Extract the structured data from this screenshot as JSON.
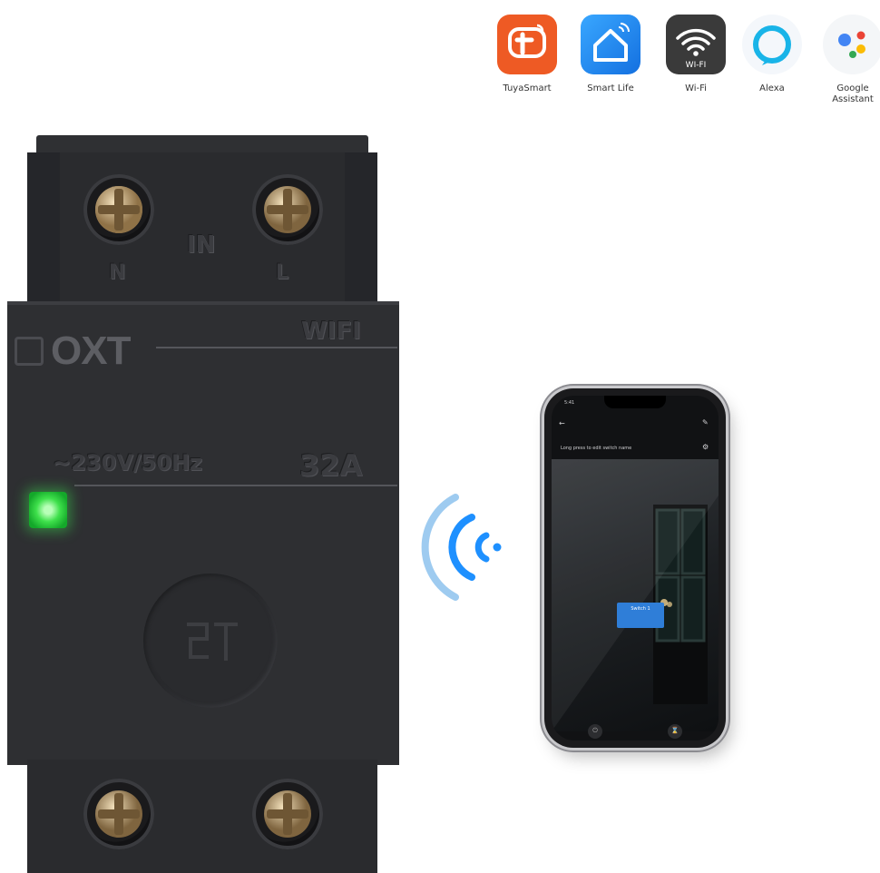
{
  "apps": [
    {
      "label": "TuyaSmart",
      "icon": "tuya-icon",
      "color": "#ee5a24"
    },
    {
      "label": "Smart Life",
      "icon": "smart-life-icon",
      "color": "#1e90ff"
    },
    {
      "label": "Wi-Fi",
      "icon": "wifi-icon",
      "color": "#3a3a3a",
      "badge": "WI-FI"
    },
    {
      "label": "Alexa",
      "icon": "alexa-icon",
      "color": "#19b4e8"
    },
    {
      "label": "Google Assistant",
      "icon": "google-assistant-icon",
      "color": "#4285f4"
    }
  ],
  "device": {
    "terminal_top_left": "N",
    "terminal_top_center": "IN",
    "terminal_top_right": "L",
    "brand": "OXT",
    "wifi_label": "WIFI",
    "voltage": "~230V/50Hz",
    "current": "32A",
    "led_color": "#3ee04b"
  },
  "phone": {
    "status_time": "5:41",
    "screen_title": "Long press to edit switch name",
    "switch_label": "Switch 1"
  },
  "colors": {
    "signal_blue": "#1e90ff",
    "signal_light": "#9ecbf0"
  }
}
